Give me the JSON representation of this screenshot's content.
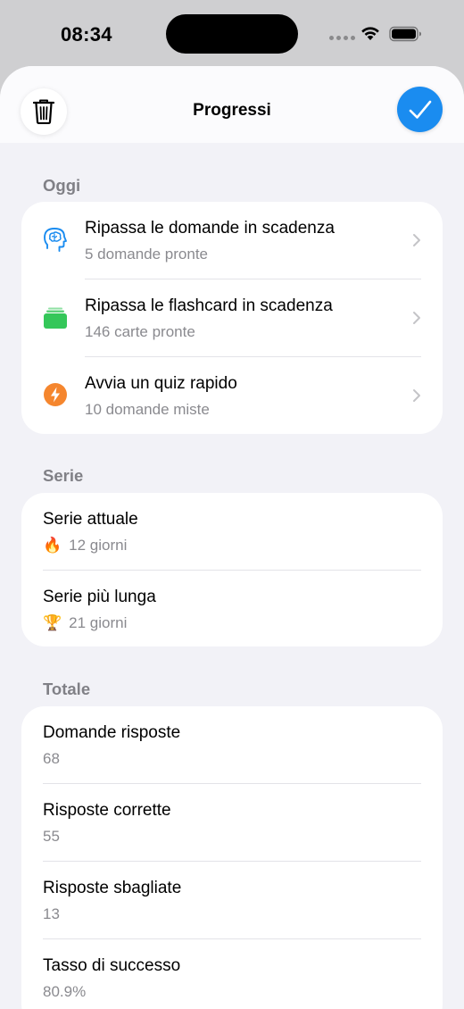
{
  "status": {
    "time": "08:34"
  },
  "nav": {
    "title": "Progressi"
  },
  "today": {
    "header": "Oggi",
    "rows": [
      {
        "title": "Ripassa le domande in scadenza",
        "subtitle": "5 domande pronte",
        "icon": "brain-icon",
        "color": "#1a8cf0"
      },
      {
        "title": "Ripassa le flashcard in scadenza",
        "subtitle": "146 carte pronte",
        "icon": "cards-icon",
        "color": "#34c759"
      },
      {
        "title": "Avvia un quiz rapido",
        "subtitle": "10 domande miste",
        "icon": "bolt-icon",
        "color": "#f5862e"
      }
    ]
  },
  "streak": {
    "header": "Serie",
    "rows": [
      {
        "title": "Serie attuale",
        "emoji": "🔥",
        "subtitle": "12 giorni"
      },
      {
        "title": "Serie più lunga",
        "emoji": "🏆",
        "subtitle": "21 giorni"
      }
    ]
  },
  "totals": {
    "header": "Totale",
    "rows": [
      {
        "title": "Domande risposte",
        "subtitle": "68"
      },
      {
        "title": "Risposte corrette",
        "subtitle": "55"
      },
      {
        "title": "Risposte sbagliate",
        "subtitle": "13"
      },
      {
        "title": "Tasso di successo",
        "subtitle": "80.9%"
      }
    ]
  }
}
